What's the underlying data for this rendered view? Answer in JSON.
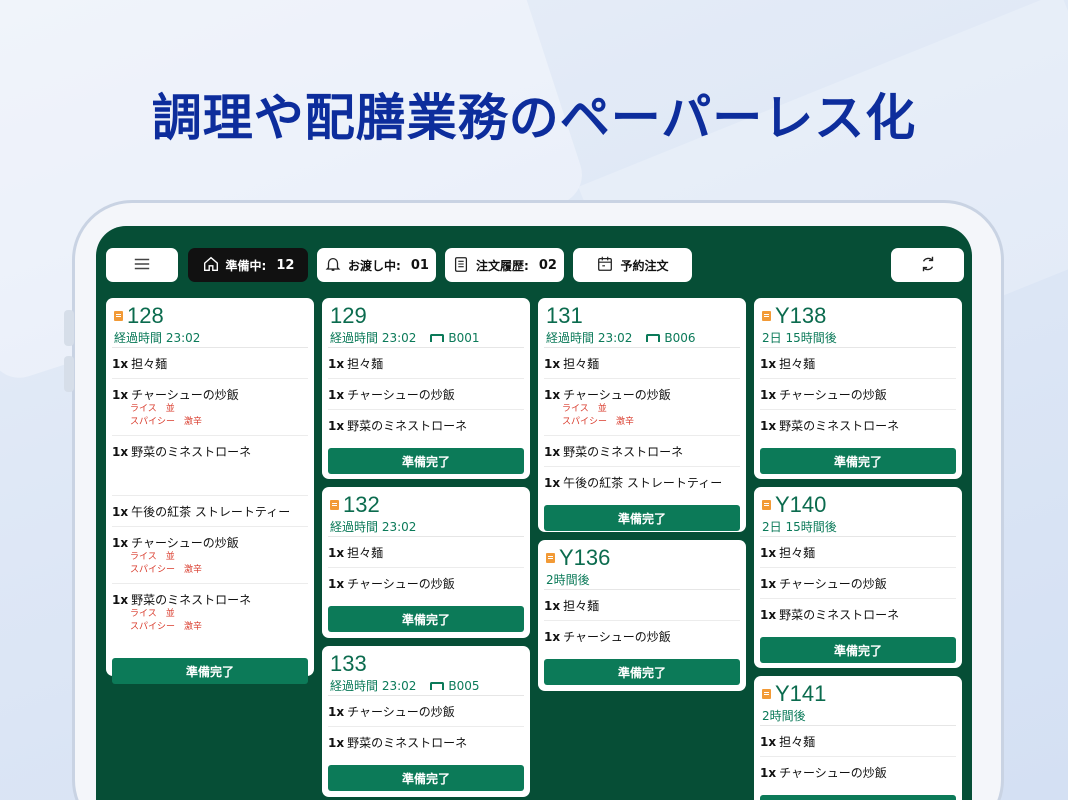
{
  "headline": "調理や配膳業務のペーパーレス化",
  "toolbar": {
    "preparing_label": "準備中:",
    "preparing_count": "12",
    "handing_label": "お渡し中:",
    "handing_count": "01",
    "history_label": "注文履歴:",
    "history_count": "02",
    "reserve_label": "予約注文"
  },
  "icons": {
    "menu": "hamburger-icon",
    "home": "home-icon",
    "bell": "bell-icon",
    "clipboard": "clipboard-icon",
    "calendar": "calendar-icon",
    "refresh": "refresh-icon",
    "order": "document-icon",
    "table": "table-icon"
  },
  "colors": {
    "screen": "#064e36",
    "accent": "#0c7a58",
    "option": "#d93a2b",
    "headline": "#0d2d9c"
  },
  "done_label": "準備完了",
  "cards": {
    "c128": {
      "no": "128",
      "meta": "経過時間 23:02",
      "items": [
        {
          "qty": "1x",
          "name": "担々麺"
        },
        {
          "qty": "1x",
          "name": "チャーシューの炒飯",
          "opts": [
            "ライス　並",
            "スパイシー　激辛"
          ]
        },
        {
          "qty": "1x",
          "name": "野菜のミネストローネ"
        },
        {
          "qty": "1x",
          "name": "午後の紅茶 ストレートティー"
        },
        {
          "qty": "1x",
          "name": "チャーシューの炒飯",
          "opts": [
            "ライス　並",
            "スパイシー　激辛"
          ]
        },
        {
          "qty": "1x",
          "name": "野菜のミネストローネ",
          "opts": [
            "ライス　並",
            "スパイシー　激辛"
          ]
        }
      ]
    },
    "c129": {
      "no": "129",
      "meta": "経過時間 23:02",
      "table": "B001",
      "items": [
        {
          "qty": "1x",
          "name": "担々麺"
        },
        {
          "qty": "1x",
          "name": "チャーシューの炒飯"
        },
        {
          "qty": "1x",
          "name": "野菜のミネストローネ"
        }
      ]
    },
    "c132": {
      "no": "132",
      "meta": "経過時間 23:02",
      "items": [
        {
          "qty": "1x",
          "name": "担々麺"
        },
        {
          "qty": "1x",
          "name": "チャーシューの炒飯"
        }
      ]
    },
    "c133": {
      "no": "133",
      "meta": "経過時間 23:02",
      "table": "B005",
      "items": [
        {
          "qty": "1x",
          "name": "チャーシューの炒飯"
        },
        {
          "qty": "1x",
          "name": "野菜のミネストローネ"
        }
      ]
    },
    "c131": {
      "no": "131",
      "meta": "経過時間 23:02",
      "table": "B006",
      "items": [
        {
          "qty": "1x",
          "name": "担々麺"
        },
        {
          "qty": "1x",
          "name": "チャーシューの炒飯",
          "opts": [
            "ライス　並",
            "スパイシー　激辛"
          ]
        },
        {
          "qty": "1x",
          "name": "野菜のミネストローネ"
        },
        {
          "qty": "1x",
          "name": "午後の紅茶 ストレートティー"
        }
      ]
    },
    "cY136": {
      "no": "Y136",
      "meta": "2時間後",
      "items": [
        {
          "qty": "1x",
          "name": "担々麺"
        },
        {
          "qty": "1x",
          "name": "チャーシューの炒飯"
        }
      ]
    },
    "cY138": {
      "no": "Y138",
      "meta": "2日 15時間後",
      "items": [
        {
          "qty": "1x",
          "name": "担々麺"
        },
        {
          "qty": "1x",
          "name": "チャーシューの炒飯"
        },
        {
          "qty": "1x",
          "name": "野菜のミネストローネ"
        }
      ]
    },
    "cY140": {
      "no": "Y140",
      "meta": "2日 15時間後",
      "items": [
        {
          "qty": "1x",
          "name": "担々麺"
        },
        {
          "qty": "1x",
          "name": "チャーシューの炒飯"
        },
        {
          "qty": "1x",
          "name": "野菜のミネストローネ"
        }
      ]
    },
    "cY141": {
      "no": "Y141",
      "meta": "2時間後",
      "items": [
        {
          "qty": "1x",
          "name": "担々麺"
        },
        {
          "qty": "1x",
          "name": "チャーシューの炒飯"
        }
      ]
    }
  }
}
